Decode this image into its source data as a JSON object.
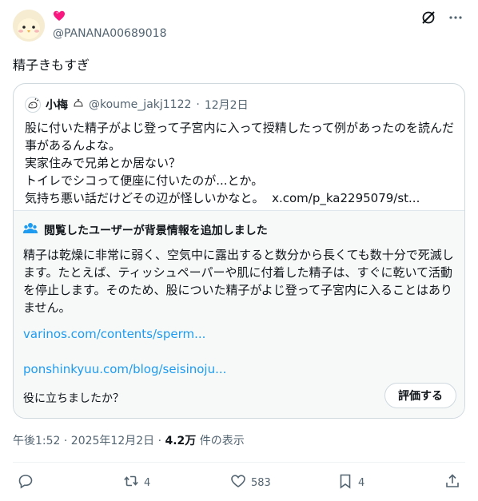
{
  "author": {
    "handle": "@PANANA00689018",
    "avatar": "chick-avatar",
    "badge_icon": "heart-icon"
  },
  "post": {
    "text": "精子きもすぎ"
  },
  "quoted": {
    "name": "小梅",
    "handle": "@koume_jakj1122",
    "separator": "·",
    "date": "12月2日",
    "lines": [
      "股に付いた精子がよじ登って子宮内に入って授精したって例があったのを読んだ",
      "事があるんよな。",
      "実家住みで兄弟とか居ない？",
      "トイレでシコって便座に付いたのが...とか。"
    ],
    "last_line": "気持ち悪い話だけどその辺が怪しいかなと。",
    "link": "x.com/p_ka2295079/st..."
  },
  "community_note": {
    "title": "閲覧したユーザーが背景情報を追加しました",
    "lines": [
      "精子は乾燥に非常に弱く、空気中に露出すると数分から長くても数十分で死滅し",
      "ます。たとえば、ティッシュペーパーや肌に付着した精子は、すぐに乾いて活動",
      "を停止します。そのため、股についた精子がよじ登って子宮内に入ることはあり",
      "ません。"
    ],
    "links": [
      "varinos.com/contents/sperm...",
      "ponshinkyuu.com/blog/seisinoju..."
    ],
    "question": "役に立ちましたか？",
    "rate_button": "評価する"
  },
  "meta": {
    "time": "午後1:52 · 2025年12月2日 · ",
    "views": "4.2万",
    "views_label": " 件の表示"
  },
  "actions": {
    "reply_count": "",
    "repost_count": "4",
    "like_count": "583",
    "bookmark_count": "4"
  },
  "colors": {
    "accent": "#1d9bf0",
    "text": "#0f1419",
    "muted": "#536471",
    "heart": "#f91880"
  }
}
